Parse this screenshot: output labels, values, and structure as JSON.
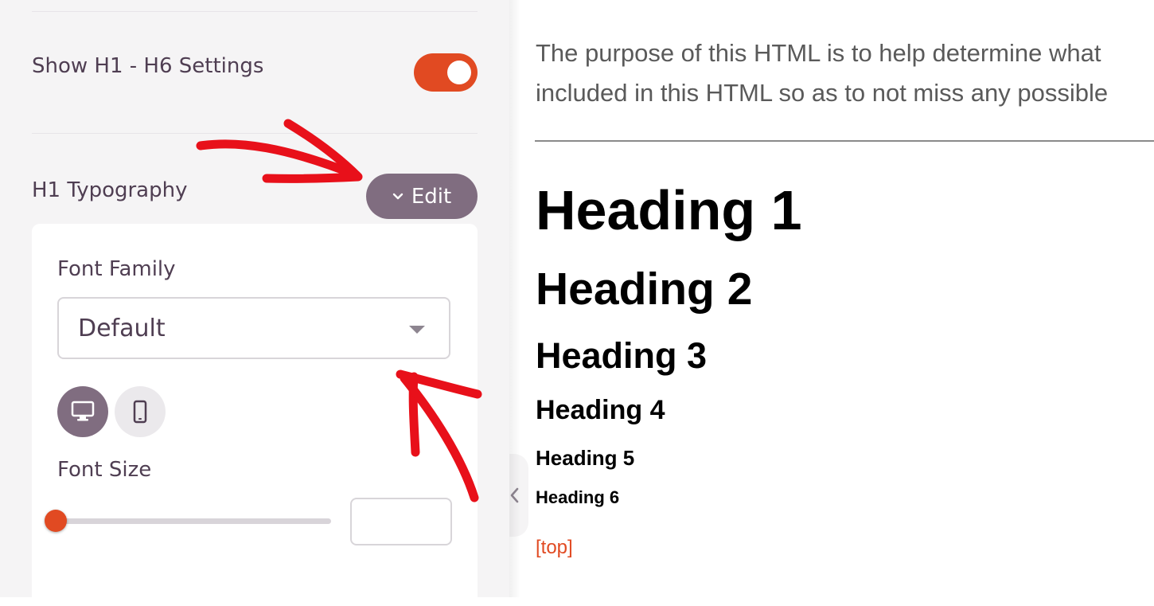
{
  "settings": {
    "show_headings": {
      "label": "Show H1 - H6 Settings",
      "enabled": true
    },
    "h1_typography": {
      "label": "H1 Typography",
      "edit_button": "Edit",
      "font_family": {
        "label": "Font Family",
        "value": "Default"
      },
      "devices": [
        {
          "name": "desktop",
          "icon": "desktop-icon",
          "active": true
        },
        {
          "name": "mobile",
          "icon": "mobile-icon",
          "active": false
        }
      ],
      "font_size": {
        "label": "Font Size",
        "slider_value": 0,
        "input_value": ""
      }
    }
  },
  "preview": {
    "intro_line_1": "The purpose of this HTML is to help determine what",
    "intro_line_2": "included in this HTML so as to not miss any possible",
    "headings": [
      "Heading 1",
      "Heading 2",
      "Heading 3",
      "Heading 4",
      "Heading 5",
      "Heading 6"
    ],
    "top_link": "[top]"
  },
  "colors": {
    "accent": "#e14a22",
    "button": "#806d80",
    "panel_bg": "#f5f4f5",
    "annotation": "#e8101a"
  }
}
